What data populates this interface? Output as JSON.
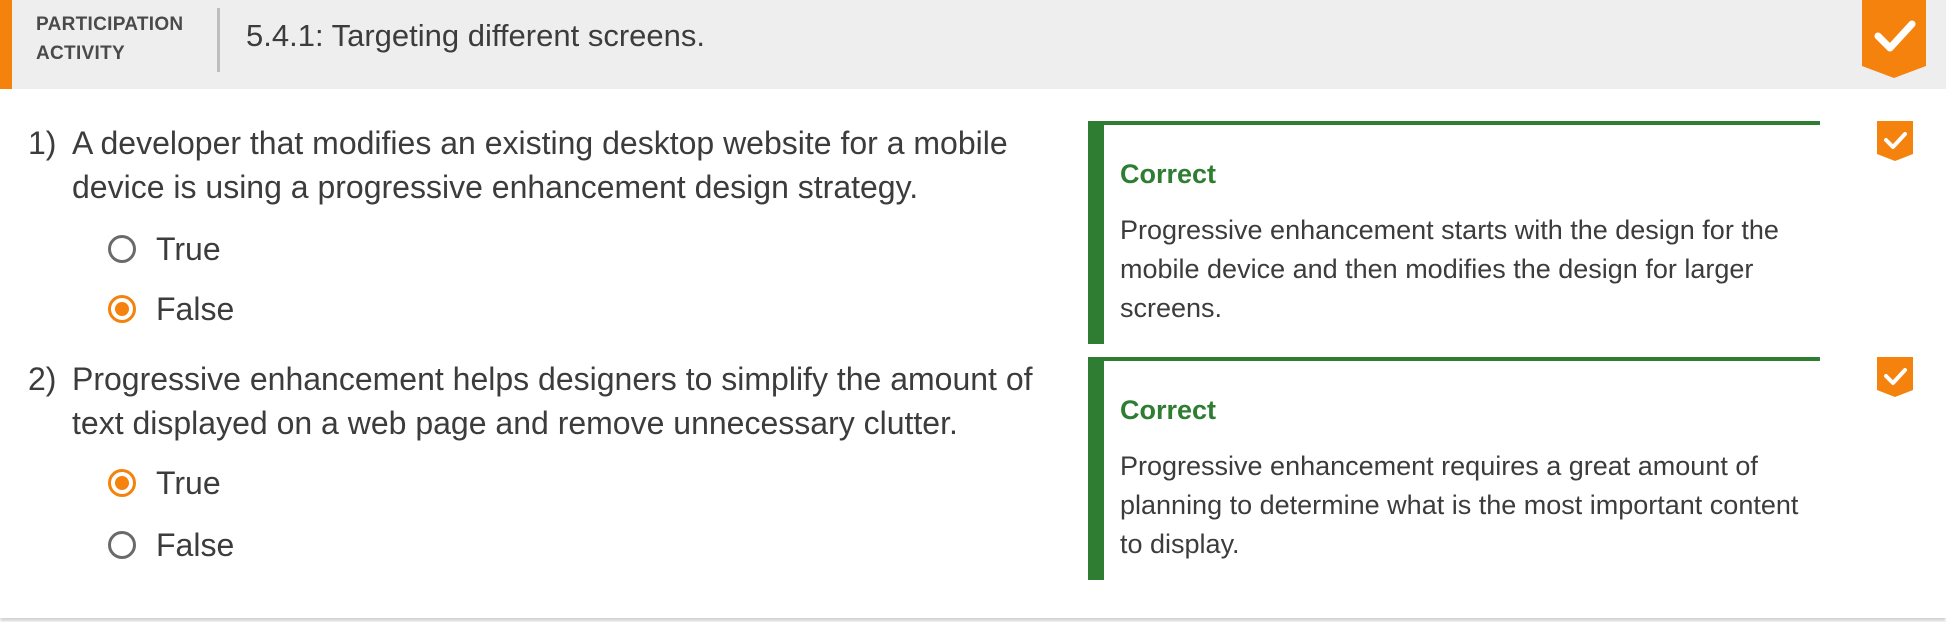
{
  "header": {
    "activity_type": "PARTICIPATION ACTIVITY",
    "title": "5.4.1: Targeting different screens.",
    "completion_icon": "checkmark-badge-icon"
  },
  "colors": {
    "accent": "#f5820d",
    "correct": "#2e7d32",
    "header_bg": "#eeeeee",
    "text": "#3c3c3c"
  },
  "questions": [
    {
      "number": "1)",
      "text": "A developer that modifies an existing desktop website for a mobile device is using a progressive enhancement design strategy.",
      "options": [
        {
          "label": "True",
          "selected": false
        },
        {
          "label": "False",
          "selected": true
        }
      ],
      "feedback": {
        "heading": "Correct",
        "text": "Progressive enhancement starts with the design for the mobile device and then modifies the design for larger screens."
      },
      "status_icon": "check-icon"
    },
    {
      "number": "2)",
      "text": "Progressive enhancement helps designers to simplify the amount of text displayed on a web page and remove unnecessary clutter.",
      "options": [
        {
          "label": "True",
          "selected": true
        },
        {
          "label": "False",
          "selected": false
        }
      ],
      "feedback": {
        "heading": "Correct",
        "text": "Progressive enhancement requires a great amount of planning to determine what is the most important content to display."
      },
      "status_icon": "check-icon"
    }
  ]
}
